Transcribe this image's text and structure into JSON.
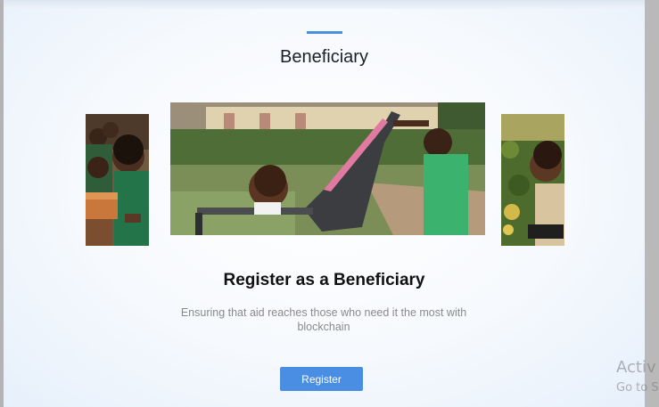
{
  "section": {
    "title": "Beneficiary",
    "accent_color": "#4a90e2"
  },
  "carousel": {
    "images": [
      {
        "name": "children-with-box",
        "role": "side-left"
      },
      {
        "name": "child-pushing-stroller",
        "role": "center"
      },
      {
        "name": "boy-in-garden",
        "role": "side-right"
      }
    ]
  },
  "hero": {
    "headline": "Register as a Beneficiary",
    "description": "Ensuring that aid reaches those who need it the most with blockchain"
  },
  "actions": {
    "register_label": "Register",
    "button_color": "#4a8ee3"
  },
  "os_watermark": {
    "line1": "Activ",
    "line2": "Go to S"
  }
}
